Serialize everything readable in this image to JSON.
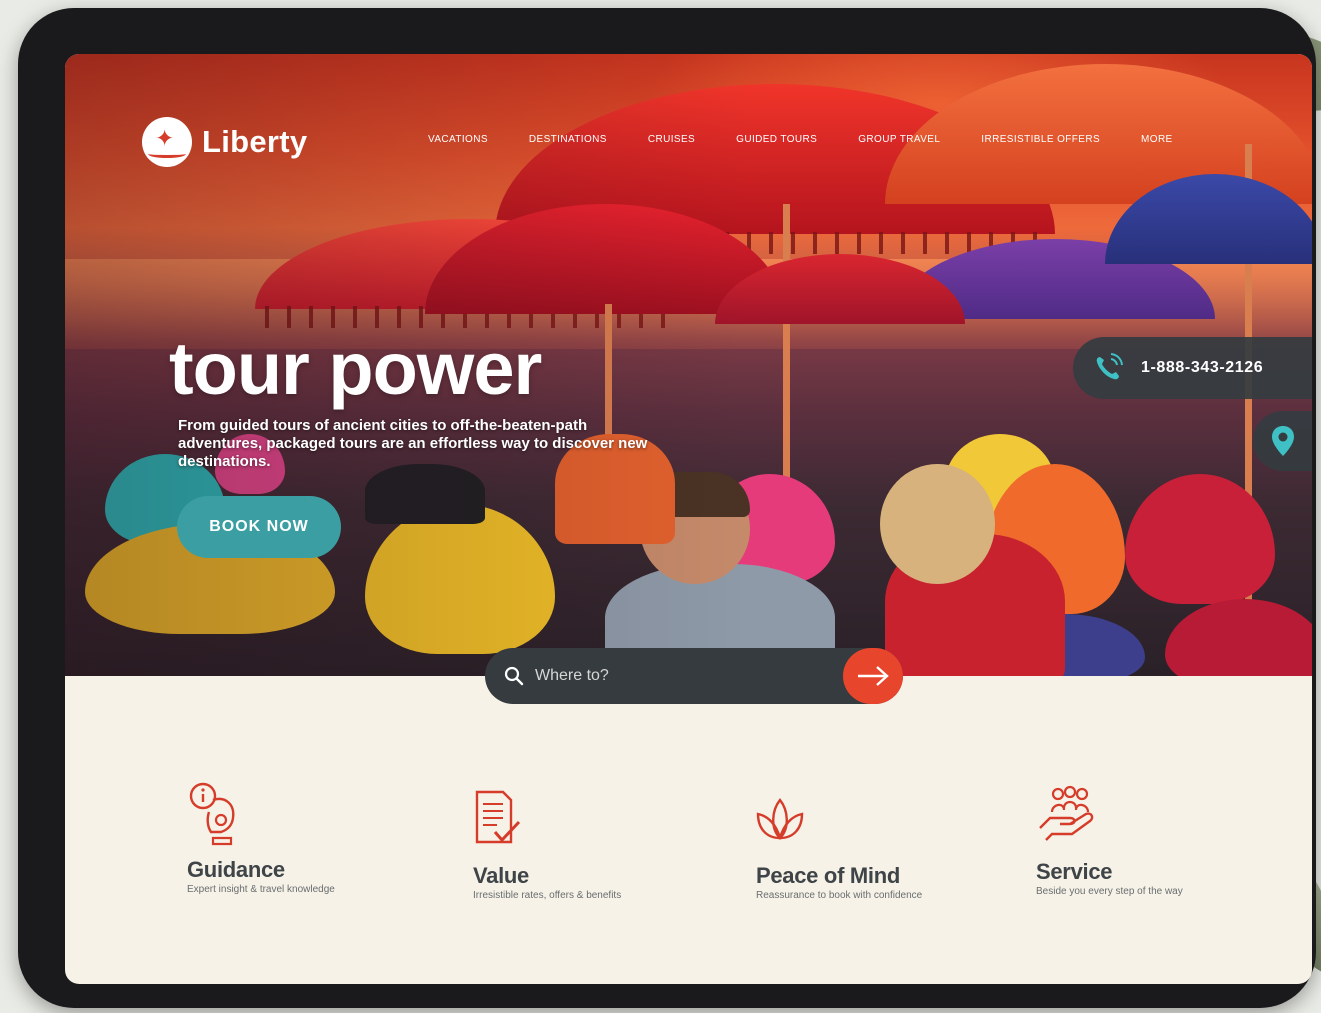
{
  "brand": {
    "name": "Liberty",
    "logo_icon": "compass-star-icon",
    "accent_color": "#d63c2a",
    "teal_color": "#3a9ea2"
  },
  "nav": {
    "items": [
      {
        "label": "VACATIONS"
      },
      {
        "label": "DESTINATIONS"
      },
      {
        "label": "CRUISES"
      },
      {
        "label": "GUIDED TOURS"
      },
      {
        "label": "GROUP TRAVEL"
      },
      {
        "label": "IRRESISTIBLE OFFERS"
      },
      {
        "label": "MORE"
      }
    ]
  },
  "hero": {
    "title": "tour power",
    "subtitle": "From guided tours of ancient cities to off-the-beaten-path adventures, packaged tours are an effortless way to discover new destinations.",
    "cta_label": "BOOK NOW"
  },
  "contact": {
    "phone_icon": "phone-icon",
    "phone_number": "1-888-343-2126",
    "location_icon": "map-pin-icon"
  },
  "search": {
    "placeholder": "Where to?",
    "value": "",
    "go_icon": "arrow-right-icon"
  },
  "features": [
    {
      "icon": "guide-info-icon",
      "title": "Guidance",
      "description": "Expert insight & travel knowledge"
    },
    {
      "icon": "document-check-icon",
      "title": "Value",
      "description": "Irresistible rates, offers & benefits"
    },
    {
      "icon": "lotus-icon",
      "title": "Peace of Mind",
      "description": "Reassurance to book with confidence"
    },
    {
      "icon": "group-hand-icon",
      "title": "Service",
      "description": "Beside you every step of the way"
    }
  ]
}
